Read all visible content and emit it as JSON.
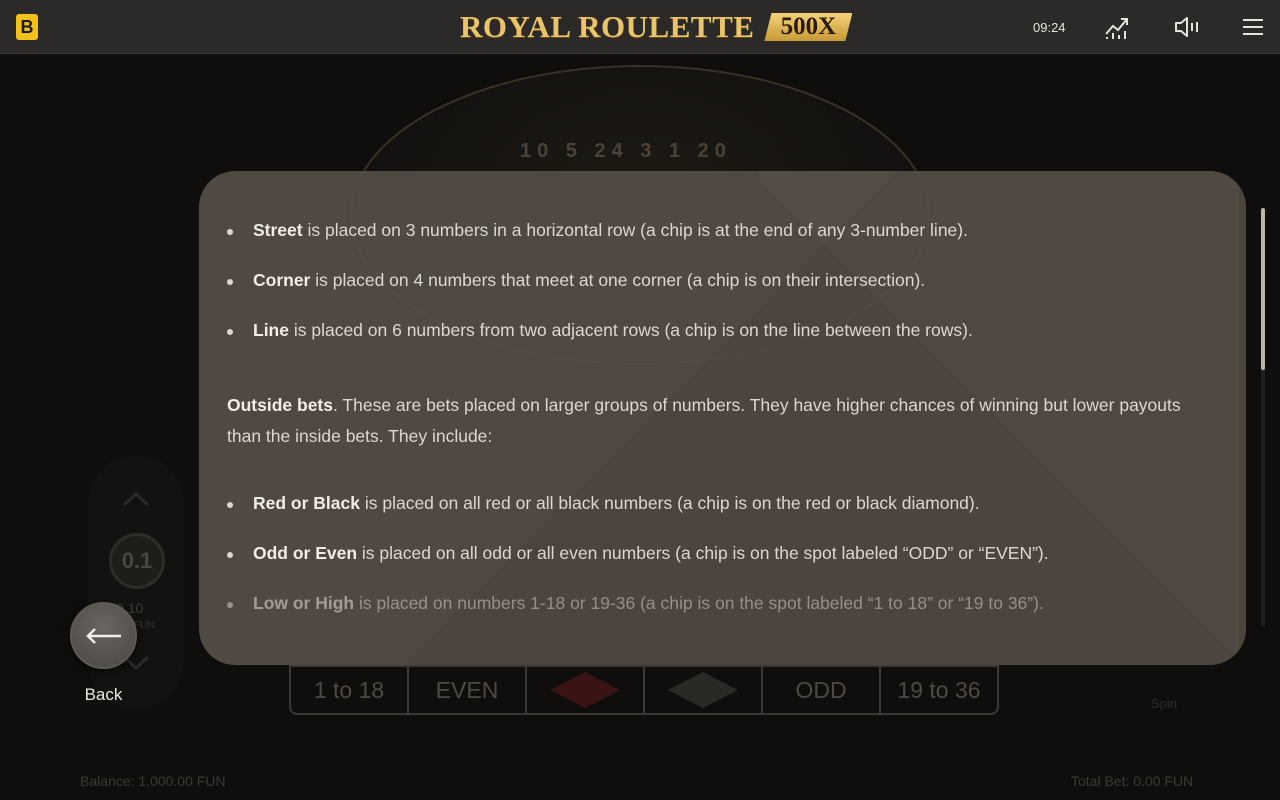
{
  "header": {
    "brand_badge": "B",
    "logo_text": "ROYAL ROULETTE",
    "logo_multiplier": "500X",
    "clock": "09:24",
    "icons": [
      "stats-icon",
      "sound-icon",
      "menu-icon"
    ]
  },
  "scene": {
    "wheel_numbers": "10 5 24   3 1 20",
    "bet_row": [
      "1 to 18",
      "EVEN",
      "",
      "",
      "ODD",
      "19 to 36"
    ],
    "balance": "Balance: 1,000.00 FUN",
    "total_bet": "Total Bet: 0.00 FUN",
    "spin_label": "Spin",
    "chip_value": "0.1",
    "chip_amount": "0.10",
    "chip_currency": "FUN"
  },
  "help": {
    "inside_items": [
      {
        "term": "Street",
        "text": " is placed on 3 numbers in a horizontal row (a chip is at the end of any 3-number line)."
      },
      {
        "term": "Corner",
        "text": " is placed on 4 numbers that meet at one corner (a chip is on their intersection)."
      },
      {
        "term": "Line",
        "text": " is placed on 6 numbers from two adjacent rows (a chip is on the line between the rows)."
      }
    ],
    "outside_intro_term": "Outside bets",
    "outside_intro_text": ". These are bets placed on larger groups of numbers. They have higher chances of winning but lower payouts than the inside bets. They include:",
    "outside_items": [
      {
        "term": "Red or Black",
        "text": " is placed on all red or all black numbers (a chip is on the red or black diamond)."
      },
      {
        "term": "Odd or Even",
        "text": " is placed on all odd or all even numbers (a chip is on the spot labeled “ODD” or “EVEN”)."
      },
      {
        "term": "Low or High",
        "text": " is placed on numbers 1-18 or 19-36 (a chip is on the spot labeled “1 to 18” or “19 to 36”)."
      }
    ]
  },
  "back": {
    "label": "Back"
  },
  "colors": {
    "accent_gold": "#e9c46a",
    "brand_yellow": "#f3c21a",
    "modal_bg": "#504a42"
  }
}
